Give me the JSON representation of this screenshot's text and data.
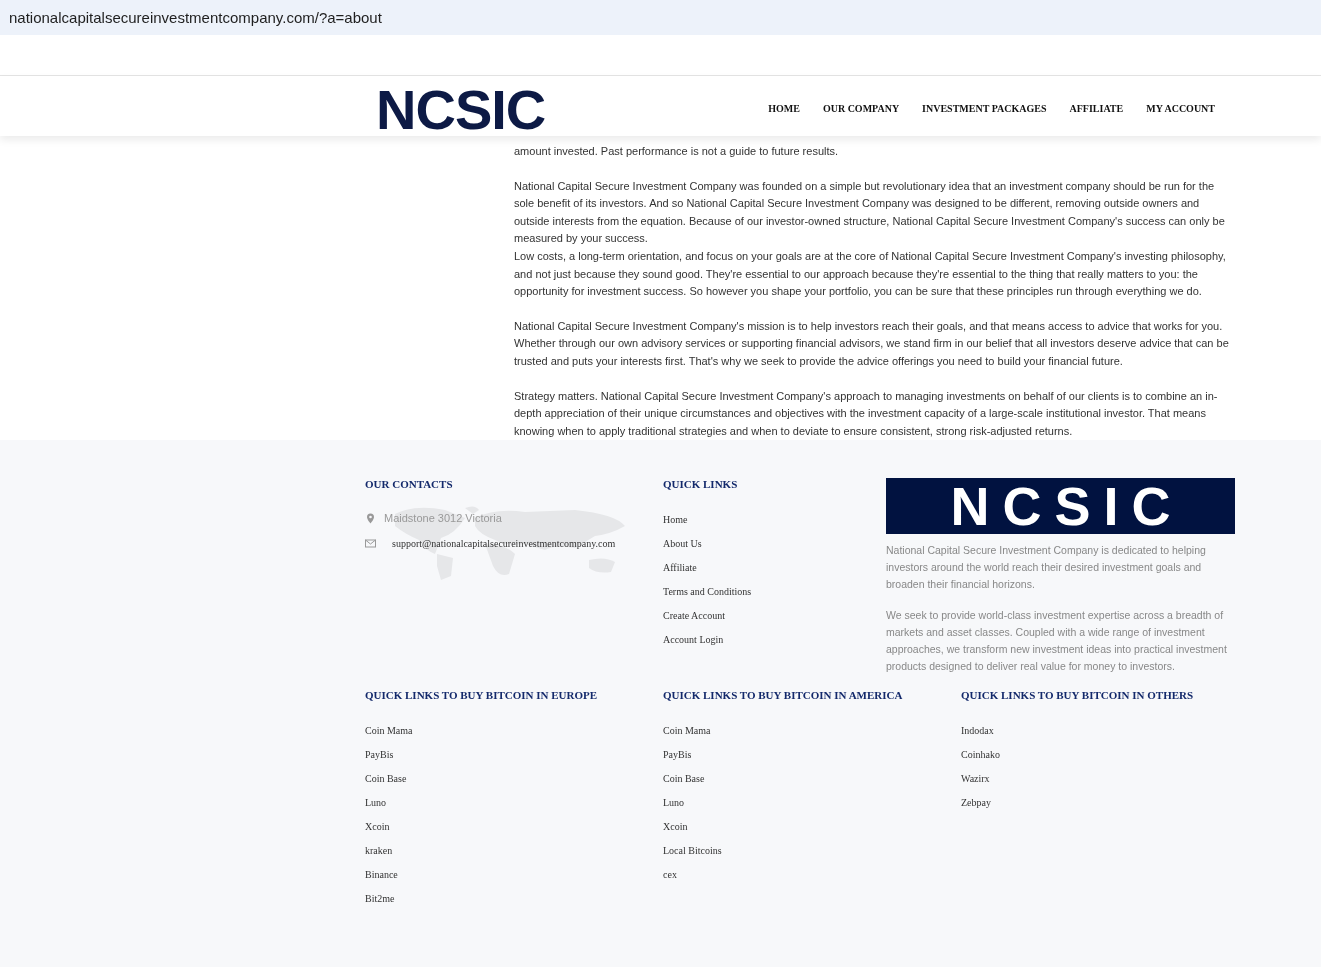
{
  "address_bar": {
    "url": "nationalcapitalsecureinvestmentcompany.com/?a=about"
  },
  "header": {
    "logo": "NCSIC",
    "nav": [
      "HOME",
      "OUR COMPANY",
      "INVESTMENT PACKAGES",
      "AFFILIATE",
      "MY ACCOUNT"
    ]
  },
  "content": {
    "paragraphs": [
      [
        "amount invested. Past performance is not a guide to future results."
      ],
      [
        "National Capital Secure Investment Company was founded on a simple but revolutionary idea that an investment company should be run for the sole benefit of its investors. And so National Capital Secure Investment Company was designed to be different, removing outside owners and outside interests from the equation. Because of our investor-owned structure, National Capital Secure Investment Company's success can only be measured by your success.",
        "Low costs, a long-term orientation, and focus on your goals are at the core of National Capital Secure Investment Company's investing philosophy, and not just because they sound good. They're essential to our approach because they're essential to the thing that really matters to you: the opportunity for investment success. So however you shape your portfolio, you can be sure that these principles run through everything we do."
      ],
      [
        "National Capital Secure Investment Company's mission is to help investors reach their goals, and that means access to advice that works for you. Whether through our own advisory services or supporting financial advisors, we stand firm in our belief that all investors deserve advice that can be trusted and puts your interests first. That's why we seek to provide the advice offerings you need to build your financial future."
      ],
      [
        "Strategy matters. National Capital Secure Investment Company's approach to managing investments on behalf of our clients is to combine an in-depth appreciation of their unique circumstances and objectives with the investment capacity of a large-scale institutional investor. That means knowing when to apply traditional strategies and when to deviate to ensure consistent, strong risk-adjusted returns."
      ]
    ]
  },
  "footer": {
    "contacts": {
      "title": "OUR CONTACTS",
      "address": "Maidstone 3012 Victoria",
      "email": "support@nationalcapitalsecureinvestmentcompany.com"
    },
    "quick_links": {
      "title": "QUICK LINKS",
      "links": [
        "Home",
        "About Us",
        "Affiliate",
        "Terms and Conditions",
        "Create Account",
        "Account Login"
      ]
    },
    "about": {
      "logo": "NCSIC",
      "paragraphs": [
        "National Capital Secure Investment Company is dedicated to helping investors around the world reach their desired investment goals and broaden their financial horizons.",
        "We seek to provide world-class investment expertise across a breadth of markets and asset classes. Coupled with a wide range of investment approaches, we transform new investment ideas into practical investment products designed to deliver real value for money to investors."
      ]
    },
    "bitcoin_sections": [
      {
        "title": "QUICK LINKS TO BUY BITCOIN IN EUROPE",
        "links": [
          "Coin Mama",
          "PayBis",
          "Coin Base",
          "Luno",
          "Xcoin",
          "kraken",
          "Binance",
          "Bit2me"
        ]
      },
      {
        "title": "QUICK LINKS TO BUY BITCOIN IN AMERICA",
        "links": [
          "Coin Mama",
          "PayBis",
          "Coin Base",
          "Luno",
          "Xcoin",
          "Local Bitcoins",
          "cex"
        ]
      },
      {
        "title": "QUICK LINKS TO BUY BITCOIN IN OTHERS",
        "links": [
          "Indodax",
          "Coinhako",
          "Wazirx",
          "Zebpay"
        ]
      }
    ]
  }
}
